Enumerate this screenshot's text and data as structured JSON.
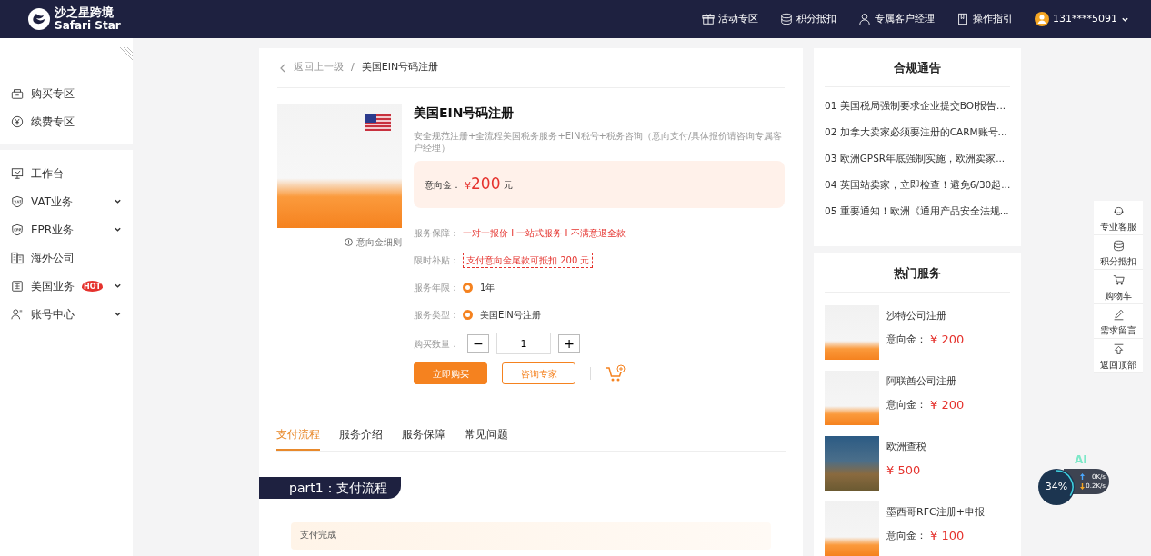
{
  "navbar": {
    "logo": {
      "name": "沙之星跨境",
      "subtitle": "Safari Star"
    },
    "links": [
      {
        "label": "活动专区",
        "kind": "gift"
      },
      {
        "label": "积分抵扣",
        "kind": "coins"
      },
      {
        "label": "专属客户经理",
        "kind": "person"
      },
      {
        "label": "操作指引",
        "kind": "book"
      }
    ],
    "user": {
      "phone": "131****5091"
    }
  },
  "sidebar": {
    "groups": [
      [
        {
          "label": "购买专区",
          "kind": "bag",
          "expandable": false
        },
        {
          "label": "续费专区",
          "kind": "yen",
          "expandable": false
        }
      ],
      [
        {
          "label": "工作台",
          "kind": "monitor",
          "expandable": false
        },
        {
          "label": "VAT业务",
          "kind": "vat",
          "expandable": true
        },
        {
          "label": "EPR业务",
          "kind": "epr",
          "expandable": true
        },
        {
          "label": "海外公司",
          "kind": "building",
          "expandable": false
        },
        {
          "label": "美国业务",
          "kind": "tax",
          "expandable": true,
          "badge": "HOT"
        },
        {
          "label": "账号中心",
          "kind": "users",
          "expandable": true
        }
      ]
    ]
  },
  "breadcrumb": {
    "back": "返回上一级",
    "separator": "/",
    "current": "美国EIN号码注册"
  },
  "product": {
    "title": "美国EIN号码注册",
    "subtitle": "安全规范注册+全流程美国税务服务+EIN税号+税务咨询（意向支付/具体报价请咨询专属客户经理）",
    "deposit": {
      "label": "意向金：",
      "currency": "¥",
      "amount": "200",
      "unit": "元"
    },
    "image_note": "意向金细则",
    "rows": [
      {
        "kind": "text",
        "label": "服务保障：",
        "value": "一对一报价 I 一站式服务 I 不满意退全款"
      },
      {
        "kind": "coupon",
        "label": "限时补贴：",
        "value": "支付意向金尾款可抵扣 200 元"
      },
      {
        "kind": "radio",
        "label": "服务年限：",
        "options": [
          {
            "label": "1年",
            "selected": true
          }
        ]
      },
      {
        "kind": "radio",
        "label": "服务类型：",
        "options": [
          {
            "label": "美国EIN号注册",
            "selected": true
          }
        ]
      },
      {
        "kind": "stepper",
        "label": "购买数量：",
        "minus": "−",
        "value": "1",
        "plus": "+"
      }
    ],
    "buttons": [
      {
        "label": "立即购买",
        "kind": "primary"
      },
      {
        "label": "咨询专家",
        "kind": "outline"
      }
    ]
  },
  "tabs": [
    {
      "label": "支付流程",
      "selected": true
    },
    {
      "label": "服务介绍",
      "selected": false
    },
    {
      "label": "服务保障",
      "selected": false
    },
    {
      "label": "常见问题",
      "selected": false
    }
  ],
  "section_banner": "part1：支付流程",
  "step_card": {
    "title": "支付完成"
  },
  "notices": {
    "title": "合规通告",
    "items": [
      "01 美国税局强制要求企业提交BOI报告...",
      "02 加拿大卖家必须要注册的CARM账号...",
      "03 欧洲GPSR年底强制实施，欧洲卖家...",
      "04 英国站卖家，立即检查！避免6/30起...",
      "05 重要通知！欧洲《通用产品安全法规..."
    ]
  },
  "hot_services": {
    "title": "热门服务",
    "items": [
      {
        "name": "沙特公司注册",
        "price_label": "意向金：",
        "price": "¥ 200",
        "kind": "banner"
      },
      {
        "name": "阿联酋公司注册",
        "price_label": "意向金：",
        "price": "¥ 200",
        "kind": "banner"
      },
      {
        "name": "欧洲查税",
        "price": "¥ 500",
        "kind": "photo"
      },
      {
        "name": "墨西哥RFC注册+申报",
        "price_label": "意向金：",
        "price": "¥ 100",
        "kind": "banner"
      }
    ]
  },
  "float_tools": [
    {
      "label": "专业客服",
      "kind": "headset"
    },
    {
      "label": "积分抵扣",
      "kind": "coins"
    },
    {
      "label": "购物车",
      "kind": "cart"
    },
    {
      "label": "需求留言",
      "kind": "pen"
    },
    {
      "label": "返回顶部",
      "kind": "top"
    }
  ],
  "monitor_widget": {
    "badge": "AI",
    "percent": "34%",
    "upload": "0K/s",
    "download": "0.2K/s"
  }
}
